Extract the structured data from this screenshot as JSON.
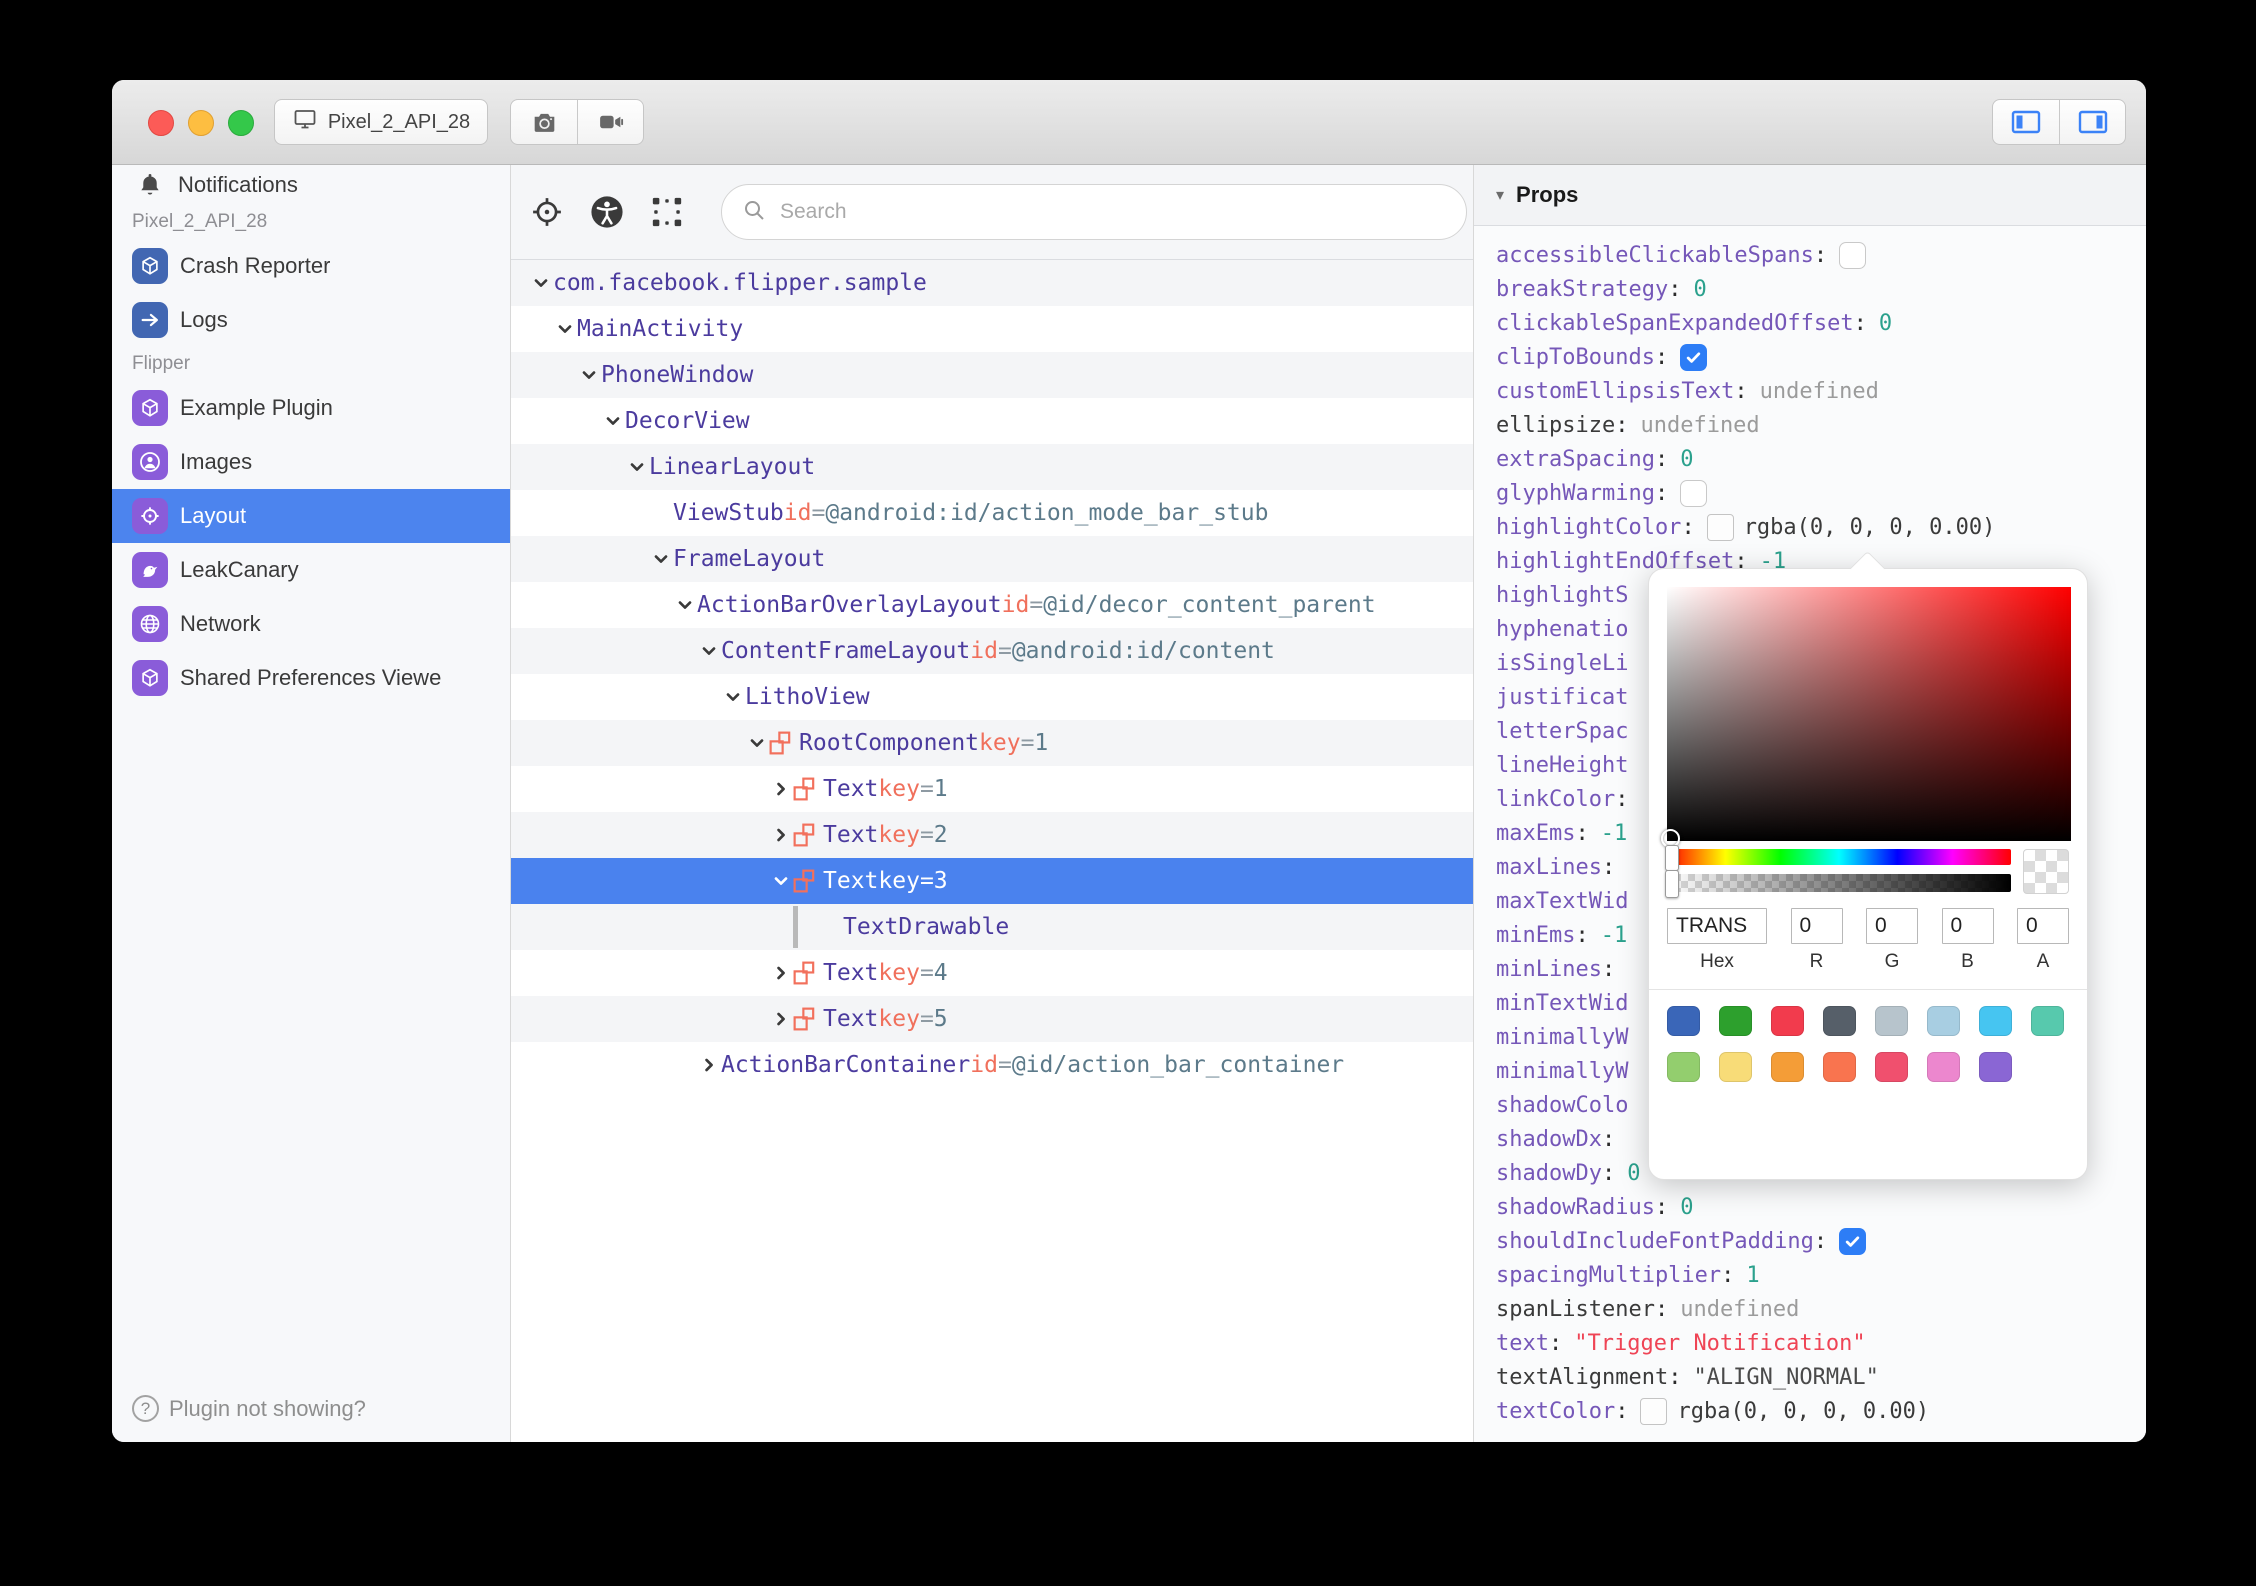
{
  "window": {
    "device": "Pixel_2_API_28"
  },
  "sidebar": {
    "notifications_label": "Notifications",
    "sections": [
      {
        "label": "Pixel_2_API_28",
        "items": [
          {
            "label": "Crash Reporter",
            "icon": "cube",
            "tile_color": "#4267B2",
            "selected": false
          },
          {
            "label": "Logs",
            "icon": "arrow",
            "tile_color": "#4267B2",
            "selected": false
          }
        ]
      },
      {
        "label": "Flipper",
        "items": [
          {
            "label": "Example Plugin",
            "icon": "cube",
            "tile_color": "#8A5CD9",
            "selected": false
          },
          {
            "label": "Images",
            "icon": "user",
            "tile_color": "#8A5CD9",
            "selected": false
          },
          {
            "label": "Layout",
            "icon": "target",
            "tile_color": "#8A5CD9",
            "selected": true
          },
          {
            "label": "LeakCanary",
            "icon": "bird",
            "tile_color": "#8A5CD9",
            "selected": false
          },
          {
            "label": "Network",
            "icon": "globe",
            "tile_color": "#8A5CD9",
            "selected": false
          },
          {
            "label": "Shared Preferences Viewe",
            "icon": "cube",
            "tile_color": "#8A5CD9",
            "selected": false
          }
        ]
      }
    ],
    "footer": "Plugin not showing?",
    "selected_color": "#4C84EE"
  },
  "toolbar": {
    "search_placeholder": "Search"
  },
  "tree": {
    "colors": {
      "name": "#4B3B9E",
      "attr": "#F0705C",
      "value": "#5C7A8A",
      "selected_bg": "#4A82EE",
      "component_icon": "#F2705C"
    },
    "rows": [
      {
        "level": 0,
        "chevron": "down",
        "icon": false,
        "name": "com.facebook.flipper.sample",
        "selected": false
      },
      {
        "level": 1,
        "chevron": "down",
        "icon": false,
        "name": "MainActivity",
        "selected": false
      },
      {
        "level": 2,
        "chevron": "down",
        "icon": false,
        "name": "PhoneWindow",
        "selected": false
      },
      {
        "level": 3,
        "chevron": "down",
        "icon": false,
        "name": "DecorView",
        "selected": false
      },
      {
        "level": 4,
        "chevron": "down",
        "icon": false,
        "name": "LinearLayout",
        "selected": false
      },
      {
        "level": 5,
        "chevron": "none",
        "icon": false,
        "name": "ViewStub",
        "attr": "id",
        "value": "@android:id/action_mode_bar_stub",
        "selected": false
      },
      {
        "level": 5,
        "chevron": "down",
        "icon": false,
        "name": "FrameLayout",
        "selected": false
      },
      {
        "level": 6,
        "chevron": "down",
        "icon": false,
        "name": "ActionBarOverlayLayout",
        "attr": "id",
        "value": "@id/decor_content_parent",
        "selected": false
      },
      {
        "level": 7,
        "chevron": "down",
        "icon": false,
        "name": "ContentFrameLayout",
        "attr": "id",
        "value": "@android:id/content",
        "selected": false
      },
      {
        "level": 8,
        "chevron": "down",
        "icon": false,
        "name": "LithoView",
        "selected": false
      },
      {
        "level": 9,
        "chevron": "down",
        "icon": true,
        "name": "RootComponent",
        "attr": "key",
        "value": "1",
        "selected": false
      },
      {
        "level": 10,
        "chevron": "right",
        "icon": true,
        "name": "Text",
        "attr": "key",
        "value": "1",
        "selected": false
      },
      {
        "level": 10,
        "chevron": "right",
        "icon": true,
        "name": "Text",
        "attr": "key",
        "value": "2",
        "selected": false
      },
      {
        "level": 10,
        "chevron": "down",
        "icon": true,
        "name": "Text",
        "attr": "key",
        "value": "3",
        "selected": true
      },
      {
        "level": 11,
        "chevron": "bar",
        "icon": false,
        "name": "TextDrawable",
        "selected": false
      },
      {
        "level": 10,
        "chevron": "right",
        "icon": true,
        "name": "Text",
        "attr": "key",
        "value": "4",
        "selected": false
      },
      {
        "level": 10,
        "chevron": "right",
        "icon": true,
        "name": "Text",
        "attr": "key",
        "value": "5",
        "selected": false
      },
      {
        "level": 7,
        "chevron": "right",
        "icon": false,
        "name": "ActionBarContainer",
        "attr": "id",
        "value": "@id/action_bar_container",
        "selected": false
      }
    ]
  },
  "props": {
    "title": "Props",
    "colors": {
      "name": "#7557B8",
      "number": "#2BA18D",
      "string": "#EF4455",
      "undefined": "#9B9B9B",
      "checkbox_on": "#2D7DF6"
    },
    "rows": [
      {
        "name": "accessibleClickableSpans",
        "type": "checkbox",
        "checked": false
      },
      {
        "name": "breakStrategy",
        "type": "number",
        "value": "0"
      },
      {
        "name": "clickableSpanExpandedOffset",
        "type": "number",
        "value": "0"
      },
      {
        "name": "clipToBounds",
        "type": "checkbox",
        "checked": true
      },
      {
        "name": "customEllipsisText",
        "type": "undefined",
        "value": "undefined"
      },
      {
        "name": "ellipsize",
        "dark": true,
        "type": "undefined",
        "value": "undefined"
      },
      {
        "name": "extraSpacing",
        "type": "number",
        "value": "0"
      },
      {
        "name": "glyphWarming",
        "type": "checkbox",
        "checked": false
      },
      {
        "name": "highlightColor",
        "type": "color",
        "value": "rgba(0, 0, 0, 0.00)"
      },
      {
        "name": "highlightEndOffset",
        "type": "number",
        "value": "-1"
      },
      {
        "name": "highlightS",
        "type": "clipped"
      },
      {
        "name": "hyphenatio",
        "type": "clipped"
      },
      {
        "name": "isSingleLi",
        "type": "clipped"
      },
      {
        "name": "justificat",
        "type": "clipped"
      },
      {
        "name": "letterSpac",
        "type": "clipped"
      },
      {
        "name": "lineHeight",
        "type": "clipped"
      },
      {
        "name": "linkColor",
        "type": "colon"
      },
      {
        "name": "maxEms",
        "type": "number",
        "value": "-1"
      },
      {
        "name": "maxLines",
        "type": "colon"
      },
      {
        "name": "maxTextWid",
        "type": "clipped"
      },
      {
        "name": "minEms",
        "type": "number",
        "value": "-1"
      },
      {
        "name": "minLines",
        "type": "colon"
      },
      {
        "name": "minTextWid",
        "type": "clipped"
      },
      {
        "name": "minimallyW",
        "type": "clipped"
      },
      {
        "name": "minimallyW",
        "type": "clipped"
      },
      {
        "name": "shadowColo",
        "type": "clipped"
      },
      {
        "name": "shadowDx",
        "type": "colon"
      },
      {
        "name": "shadowDy",
        "type": "number",
        "value": "0"
      },
      {
        "name": "shadowRadius",
        "type": "number",
        "value": "0"
      },
      {
        "name": "shouldIncludeFontPadding",
        "type": "checkbox",
        "checked": true
      },
      {
        "name": "spacingMultiplier",
        "type": "number",
        "value": "1"
      },
      {
        "name": "spanListener",
        "dark": true,
        "type": "undefined",
        "value": "undefined"
      },
      {
        "name": "text",
        "type": "string",
        "value": "\"Trigger Notification\""
      },
      {
        "name": "textAlignment",
        "dark": true,
        "type": "string-dark",
        "value": "\"ALIGN_NORMAL\""
      },
      {
        "name": "textColor",
        "type": "color",
        "value": "rgba(0, 0, 0, 0.00)"
      }
    ]
  },
  "picker": {
    "hex": "TRANS",
    "r": "0",
    "g": "0",
    "b": "0",
    "a": "0",
    "labels": {
      "hex": "Hex",
      "r": "R",
      "g": "G",
      "b": "B",
      "a": "A"
    },
    "swatches_row1": [
      "#3A66B8",
      "#2DA02D",
      "#F23B4D",
      "#565F69",
      "#B7C4CC",
      "#A8CEE2",
      "#46C5F1",
      "#57C9AD"
    ],
    "swatches_row2": [
      "#93CE6E",
      "#F8DC78",
      "#F49D37",
      "#F9744F",
      "#F0506E",
      "#EC87CE",
      "#8A66D4"
    ]
  }
}
